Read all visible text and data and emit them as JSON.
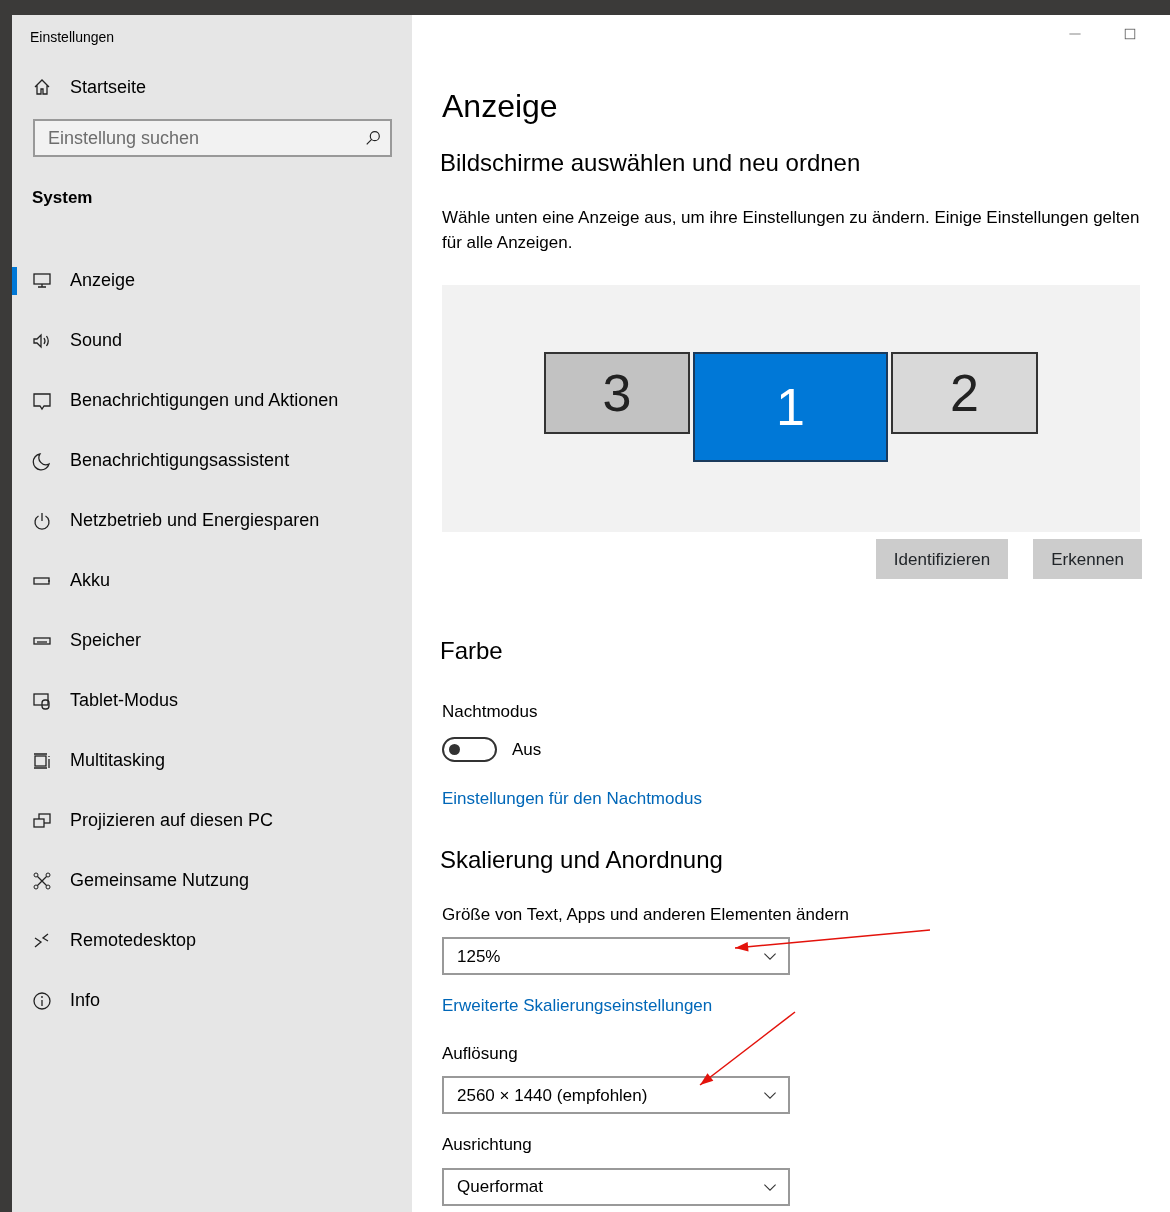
{
  "window": {
    "title": "Einstellungen"
  },
  "sidebar": {
    "home": "Startseite",
    "search": {
      "placeholder": "Einstellung suchen"
    },
    "section": "System",
    "items": [
      {
        "label": "Anzeige",
        "selected": true
      },
      {
        "label": "Sound",
        "selected": false
      },
      {
        "label": "Benachrichtigungen und Aktionen",
        "selected": false
      },
      {
        "label": "Benachrichtigungsassistent",
        "selected": false
      },
      {
        "label": "Netzbetrieb und Energiesparen",
        "selected": false
      },
      {
        "label": "Akku",
        "selected": false
      },
      {
        "label": "Speicher",
        "selected": false
      },
      {
        "label": "Tablet-Modus",
        "selected": false
      },
      {
        "label": "Multitasking",
        "selected": false
      },
      {
        "label": "Projizieren auf diesen PC",
        "selected": false
      },
      {
        "label": "Gemeinsame Nutzung",
        "selected": false
      },
      {
        "label": "Remotedesktop",
        "selected": false
      },
      {
        "label": "Info",
        "selected": false
      }
    ]
  },
  "main": {
    "title": "Anzeige",
    "arrange_heading": "Bildschirme auswählen und neu ordnen",
    "arrange_text": "Wähle unten eine Anzeige aus, um ihre Einstellungen zu ändern. Einige Einstellungen gelten für alle Anzeigen.",
    "monitors": [
      {
        "label": "3",
        "selected": false,
        "color": "#c2c2c2"
      },
      {
        "label": "1",
        "selected": true,
        "color": "#0078d7"
      },
      {
        "label": "2",
        "selected": false,
        "color": "#d9d9d9"
      }
    ],
    "buttons": [
      "Identifizieren",
      "Erkennen"
    ],
    "color_heading": "Farbe",
    "night_mode": {
      "label": "Nachtmodus",
      "on": false,
      "state_text": "Aus"
    },
    "night_link": "Einstellungen für den Nachtmodus",
    "scale_heading": "Skalierung und Anordnung",
    "fields": [
      {
        "label": "Größe von Text, Apps und anderen Elementen ändern",
        "value": "125%"
      },
      {
        "link": "Erweiterte Skalierungseinstellungen"
      },
      {
        "label": "Auflösung",
        "value": "2560 × 1440 (empfohlen)"
      },
      {
        "label": "Ausrichtung",
        "value": "Querformat"
      }
    ]
  },
  "annotations": [
    {
      "kind": "arrow"
    },
    {
      "kind": "arrow"
    }
  ]
}
